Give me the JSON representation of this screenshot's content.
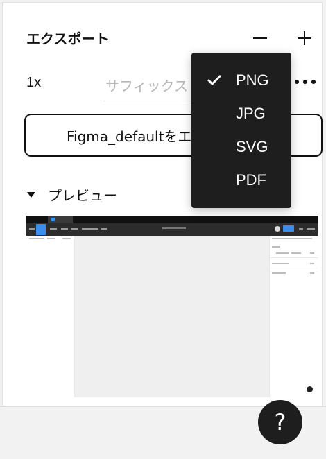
{
  "export_section": {
    "title": "エクスポート",
    "scale": "1x",
    "suffix_placeholder": "サフィックス",
    "export_button_label": "Figma_defaultをエ",
    "preview_label": "プレビュー"
  },
  "format_menu": {
    "items": [
      {
        "label": "PNG",
        "selected": true
      },
      {
        "label": "JPG",
        "selected": false
      },
      {
        "label": "SVG",
        "selected": false
      },
      {
        "label": "PDF",
        "selected": false
      }
    ]
  },
  "help": {
    "label": "?"
  },
  "icons": {
    "remove": "minus-icon",
    "add": "plus-icon",
    "more": "more-horizontal-icon",
    "collapse": "caret-down-icon",
    "checkmark": "checkmark-icon"
  },
  "colors": {
    "menu_bg": "#1e1e1e",
    "accent": "#3b8df0"
  }
}
